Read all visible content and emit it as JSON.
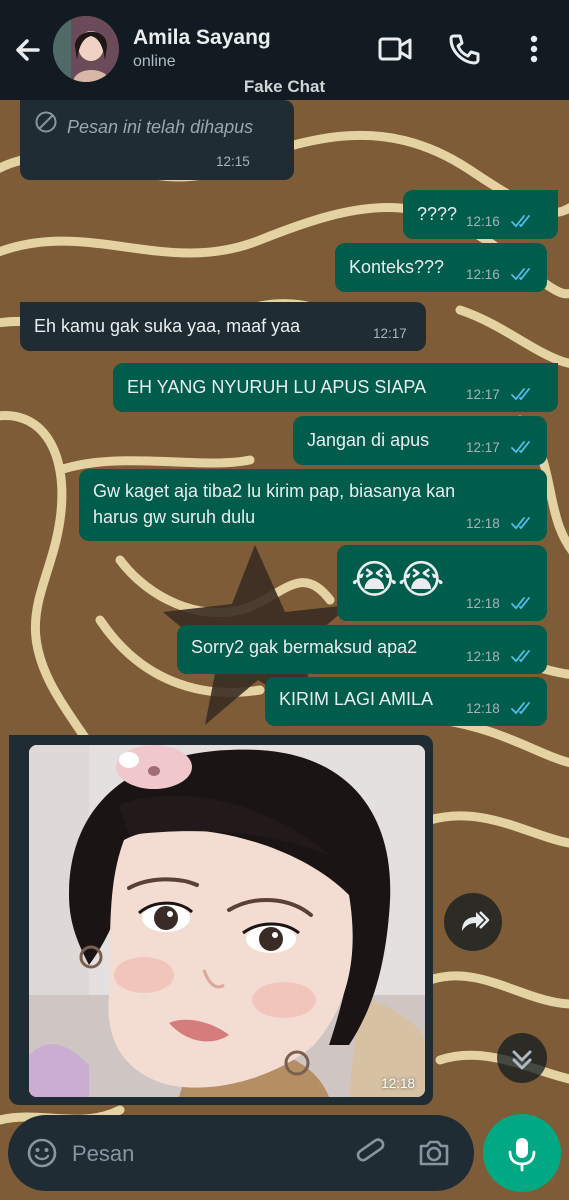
{
  "header": {
    "contact_name": "Amila Sayang",
    "status": "online",
    "watermark": "Fake Chat"
  },
  "messages": [
    {
      "dir": "in",
      "text": "Pesan ini telah dihapus",
      "time": "12:15",
      "deleted": true
    },
    {
      "dir": "out",
      "text": "????",
      "time": "12:16",
      "read": true
    },
    {
      "dir": "out",
      "text": "Konteks???",
      "time": "12:16",
      "read": true
    },
    {
      "dir": "in",
      "text": "Eh kamu gak suka yaa, maaf yaa",
      "time": "12:17"
    },
    {
      "dir": "out",
      "text": "EH YANG NYURUH LU APUS SIAPA",
      "time": "12:17",
      "read": true
    },
    {
      "dir": "out",
      "text": "Jangan di apus",
      "time": "12:17",
      "read": true
    },
    {
      "dir": "out",
      "line1": "Gw kaget aja tiba2 lu kirim pap, biasanya kan",
      "line2": "harus gw suruh dulu",
      "time": "12:18",
      "read": true
    },
    {
      "dir": "out",
      "text": "😭😭",
      "time": "12:18",
      "read": true
    },
    {
      "dir": "out",
      "text": "Sorry2 gak bermaksud apa2",
      "time": "12:18",
      "read": true
    },
    {
      "dir": "out",
      "text": "KIRIM LAGI AMILA",
      "time": "12:18",
      "read": true
    },
    {
      "dir": "in",
      "type": "image",
      "time": "12:18"
    }
  ],
  "composer": {
    "placeholder": "Pesan"
  },
  "colors": {
    "header_bg": "#111b21",
    "incoming_bubble": "#202c33",
    "outgoing_bubble": "#005c4b",
    "read_tick": "#53bdeb",
    "accent": "#00a884"
  },
  "icons": [
    "back-arrow-icon",
    "video-call-icon",
    "phone-icon",
    "more-vert-icon",
    "deleted-icon",
    "double-tick-icon",
    "forward-icon",
    "scroll-down-icon",
    "emoji-icon",
    "attach-icon",
    "camera-icon",
    "mic-icon"
  ]
}
